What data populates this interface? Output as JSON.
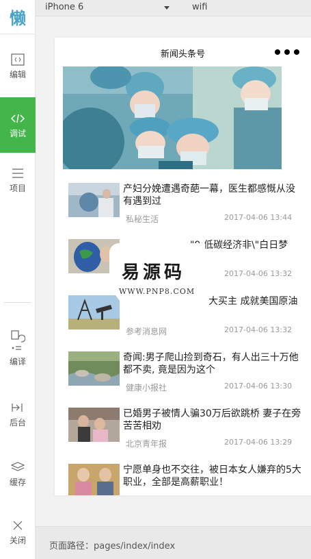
{
  "sidebar": {
    "logo_char": "懒",
    "items": [
      {
        "label": "编辑",
        "icon": "code-file-icon"
      },
      {
        "label": "调试",
        "icon": "code-icon",
        "active": true
      },
      {
        "label": "项目",
        "icon": "menu-icon"
      },
      {
        "label": "编译",
        "icon": "compile-icon"
      },
      {
        "label": "后台",
        "icon": "background-icon"
      },
      {
        "label": "缓存",
        "icon": "layers-icon"
      },
      {
        "label": "关闭",
        "icon": "close-icon"
      }
    ],
    "accent_color": "#44b549"
  },
  "toolbar": {
    "device": "iPhone 6",
    "network": "wifi"
  },
  "phone": {
    "nav_title": "新闻头条号",
    "news": [
      {
        "title": "产妇分娩遭遇奇葩一幕，医生都感慨从没有遇到过",
        "source": "私秘生活",
        "time": "2017-04-06 13:44"
      },
      {
        "title": "\"9:低碳经济非\\\"白日梦",
        "source": "",
        "time": "2017-04-06 13:32"
      },
      {
        "title": "大买主 成就美国原油",
        "source": "参考消息网",
        "time": "2017-04-06 13:32"
      },
      {
        "title": "奇闻:男子爬山捡到奇石，有人出三十万他都不卖, 竟是因为这个",
        "source": "健康小报社",
        "time": "2017-04-06 13:30"
      },
      {
        "title": "已婚男子被情人骗30万后欲跳桥 妻子在旁苦苦相劝",
        "source": "北京青年报",
        "time": "2017-04-06 13:29"
      },
      {
        "title": "宁愿单身也不交往，被日本女人嫌弃的5大职业，全部是高薪职业！",
        "source": "",
        "time": ""
      }
    ]
  },
  "watermark": {
    "main": "易源码",
    "sub": "WWW.PNP8.COM"
  },
  "path_bar": {
    "text": "页面路径：pages/index/index"
  }
}
